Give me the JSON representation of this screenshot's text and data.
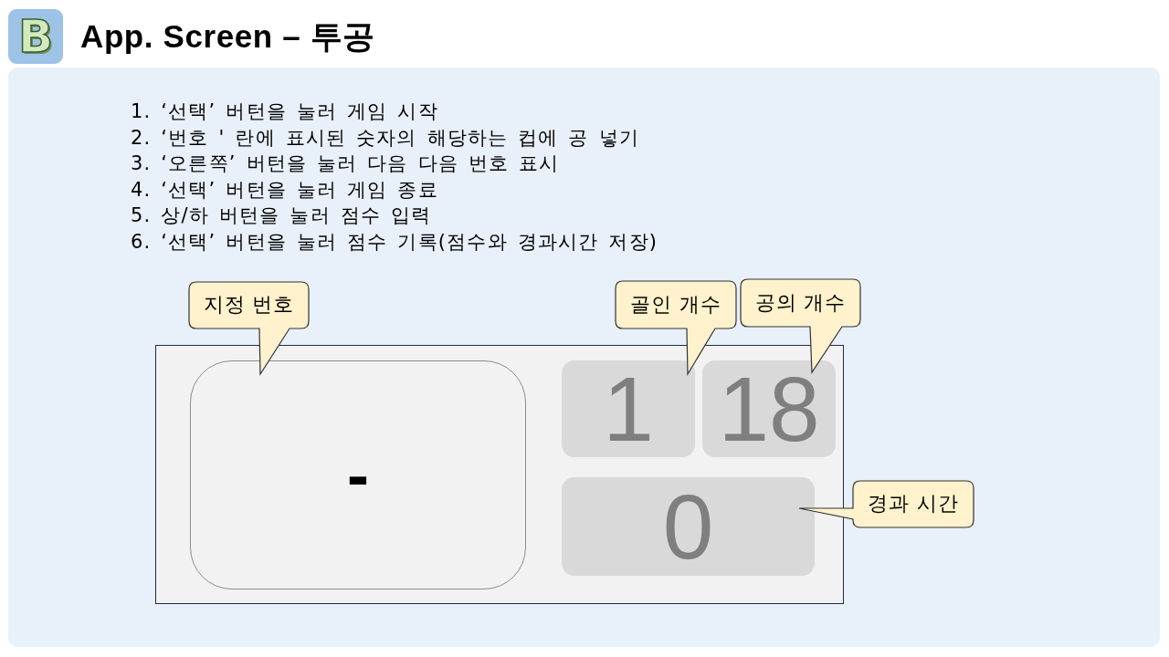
{
  "header": {
    "logo": "B",
    "title": "App. Screen – 투공"
  },
  "instructions": [
    "1. ‘선택’ 버턴을 눌러 게임 시작",
    "2. ‘번호 ' 란에 표시된 숫자의 해당하는 컵에 공 넣기",
    "3. ‘오른쪽’ 버턴을 눌러 다음 다음 번호 표시",
    "4. ‘선택’ 버턴을 눌러 게임 종료",
    "5. 상/하 버턴을 눌러 점수 입력",
    "6. ‘선택’ 버턴을 눌러 점수 기록(점수와 경과시간 저장)"
  ],
  "screen": {
    "number": "-",
    "goal_count": "1",
    "ball_count": "18",
    "elapsed_time": "0"
  },
  "callouts": [
    "지정 번호",
    "골인 개수",
    "공의 개수",
    "경과 시간"
  ]
}
